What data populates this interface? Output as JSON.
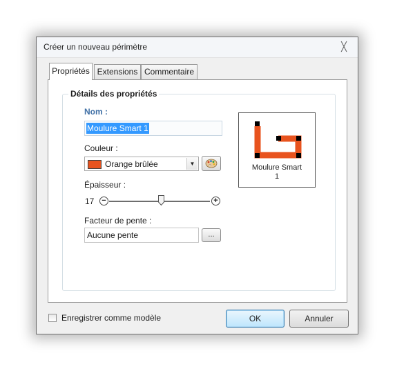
{
  "window": {
    "title": "Créer un nouveau périmètre"
  },
  "tabs": [
    {
      "label": "Propriétés",
      "active": true
    },
    {
      "label": "Extensions",
      "active": false
    },
    {
      "label": "Commentaire",
      "active": false
    }
  ],
  "group": {
    "title": "Détails des propriétés",
    "name_label": "Nom :",
    "name_value": "Moulure Smart 1",
    "color_label": "Couleur :",
    "color_value": "Orange brûlée",
    "color_hex": "#e8531e",
    "thickness_label": "Épaisseur :",
    "thickness_value": "17",
    "thickness_fraction": 0.52,
    "slope_label": "Facteur de pente :",
    "slope_value": "Aucune pente",
    "slope_button": "...",
    "preview_label_line1": "Moulure Smart",
    "preview_label_line2": "1"
  },
  "footer": {
    "save_as_template_label": "Enregistrer comme modèle",
    "save_as_template_checked": false,
    "ok_label": "OK",
    "cancel_label": "Annuler"
  },
  "icons": {
    "close": "close-icon",
    "palette": "palette-icon",
    "minus": "minus-icon",
    "plus": "plus-icon",
    "dropdown": "chevron-down-icon"
  }
}
